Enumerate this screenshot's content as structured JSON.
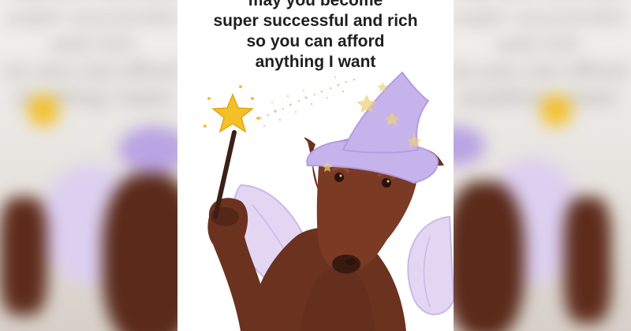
{
  "meme": {
    "caption_lines": [
      "may you become",
      "super successful and rich",
      "so you can afford",
      "anything I want"
    ]
  },
  "colors": {
    "background": "#d9d6d2",
    "panel": "#ffffff",
    "text": "#1f1f1f",
    "hat": "#c7b3ec",
    "wings": "#e3d6f2",
    "star": "#f4c02a",
    "dog": "#6b3220"
  },
  "icons": {
    "wand": "magic-wand-icon",
    "hat": "wizard-hat-icon",
    "wings": "fairy-wings-icon",
    "dog": "doberman-illustration"
  }
}
